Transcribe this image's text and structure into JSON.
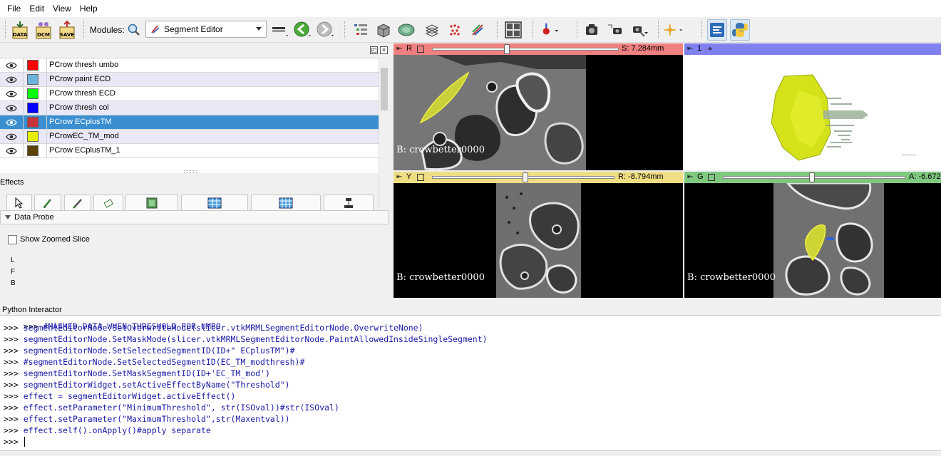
{
  "menu": [
    "File",
    "Edit",
    "View",
    "Help"
  ],
  "toolbar": {
    "data_label": "DATA",
    "dcm_label": "DCM",
    "save_label": "SAVE",
    "modules_label": "Modules:",
    "module_selected": "Segment Editor"
  },
  "segments": [
    {
      "name": "PCrow thresh umbo",
      "color": "#ff0000"
    },
    {
      "name": "PCrow paint ECD",
      "color": "#6ab4dc"
    },
    {
      "name": "PCrow thresh ECD",
      "color": "#00ff00"
    },
    {
      "name": "PCrow thresh col",
      "color": "#0000ff"
    },
    {
      "name": "PCrow ECplusTM",
      "color": "#c8323c"
    },
    {
      "name": "PCrowEC_TM_mod",
      "color": "#e6f000"
    },
    {
      "name": "PCrow ECplusTM_1",
      "color": "#5a4200"
    }
  ],
  "selected_segment_index": 4,
  "effects_label": "Effects",
  "data_probe": {
    "title": "Data Probe",
    "show_zoomed_slice": "Show Zoomed Slice",
    "l": "L",
    "f": "F",
    "b": "B"
  },
  "views": {
    "red": {
      "letter": "R",
      "offset": "S: 7.284mm",
      "label": "B: crowbetter0000",
      "color": "#f08080",
      "slider_position": 0.4
    },
    "three_d": {
      "letter": "1",
      "color": "#8080ee"
    },
    "yellow": {
      "letter": "Y",
      "offset": "R: -8.794mm",
      "label": "B: crowbetter0000",
      "color": "#eedd82",
      "slider_position": 0.51
    },
    "green": {
      "letter": "G",
      "offset": "A: -6.672",
      "label": "B: crowbetter0000",
      "color": "#7fc87f",
      "slider_position": 0.49
    }
  },
  "python": {
    "title": "Python Interactor",
    "prompt": ">>>",
    "partial_line": "#MASKED DATA WHEN THRESHOLD FOR UMBO",
    "lines": [
      "segmentEditorNode.SetOverwriteMode(slicer.vtkMRMLSegmentEditorNode.OverwriteNone)",
      "segmentEditorNode.SetMaskMode(slicer.vtkMRMLSegmentEditorNode.PaintAllowedInsideSingleSegment)",
      "segmentEditorNode.SetSelectedSegmentID(ID+\" ECplusTM\")#",
      "#segmentEditorNode.SetSelectedSegmentID(EC_TM_modthresh)#",
      "segmentEditorNode.SetMaskSegmentID(ID+'EC_TM_mod')",
      "segmentEditorWidget.setActiveEffectByName(\"Threshold\")",
      "effect = segmentEditorWidget.activeEffect()",
      "effect.setParameter(\"MinimumThreshold\", str(ISOval))#str(ISOval)",
      "effect.setParameter(\"MaximumThreshold\",str(Maxentval))",
      "effect.self().onApply()#apply separate",
      ""
    ]
  }
}
